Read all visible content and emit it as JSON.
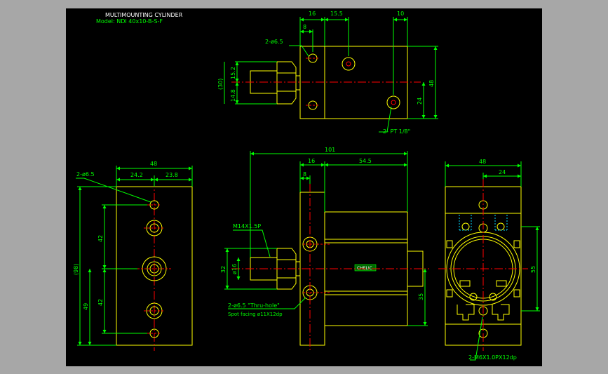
{
  "title": {
    "main": "MULTIMOUNTING CYLINDER",
    "model": "Model: NDI 40x10-B-S-F"
  },
  "top_view": {
    "dims": [
      "16",
      "15.5",
      "10",
      "8",
      "2-ø6.5",
      "15.2",
      "14.8",
      "(30)",
      "48",
      "24",
      "2- PT 1/8\""
    ]
  },
  "left_view": {
    "dims": [
      "48",
      "24.2",
      "23.8",
      "2-ø6.5",
      "(98)",
      "42",
      "42",
      "49"
    ]
  },
  "front_view": {
    "dims": [
      "101",
      "16",
      "54.5",
      "8",
      "M14X1.5P",
      "32",
      "ø16",
      "35",
      "2-ø6.5 \"Thru-hole\"",
      "Spot facing ø11X12dp"
    ],
    "nameplate": "CHELIC"
  },
  "right_view": {
    "dims": [
      "48",
      "24",
      "55",
      "2-M6X1.0PX12dp"
    ]
  },
  "colors": {
    "background": "#000000",
    "outline": "#ffff00",
    "dimension": "#00ff00",
    "centerline": "#ff0000",
    "hidden": "#00d8ff",
    "text": "#ffffff",
    "frame": "#a7a7a7"
  }
}
